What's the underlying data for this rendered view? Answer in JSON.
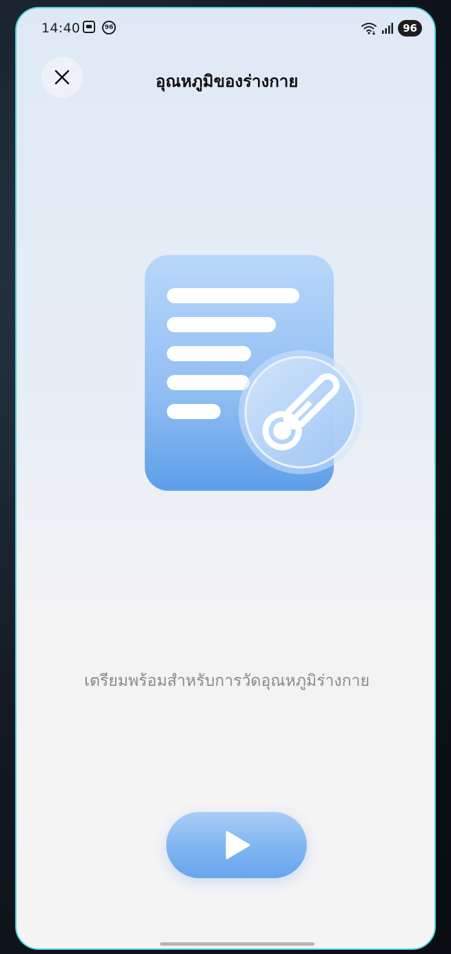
{
  "status_bar": {
    "time": "14:40",
    "notification_badge": "96",
    "battery": "96",
    "icons": [
      "screenshot-icon",
      "notification-count-icon",
      "wifi-icon",
      "signal-icon",
      "battery-icon"
    ]
  },
  "header": {
    "title": "อุณหภูมิของร่างกาย",
    "close_icon": "close-icon"
  },
  "illustration": {
    "icon": "document-thermometer-icon"
  },
  "message": "เตรียมพร้อมสำหรับการวัดอุณหภูมิร่างกาย",
  "start_button": {
    "icon": "play-icon",
    "color": "#7fb4f0"
  },
  "colors": {
    "accent": "#6aa5ec",
    "frame": "#4fd3d9"
  }
}
